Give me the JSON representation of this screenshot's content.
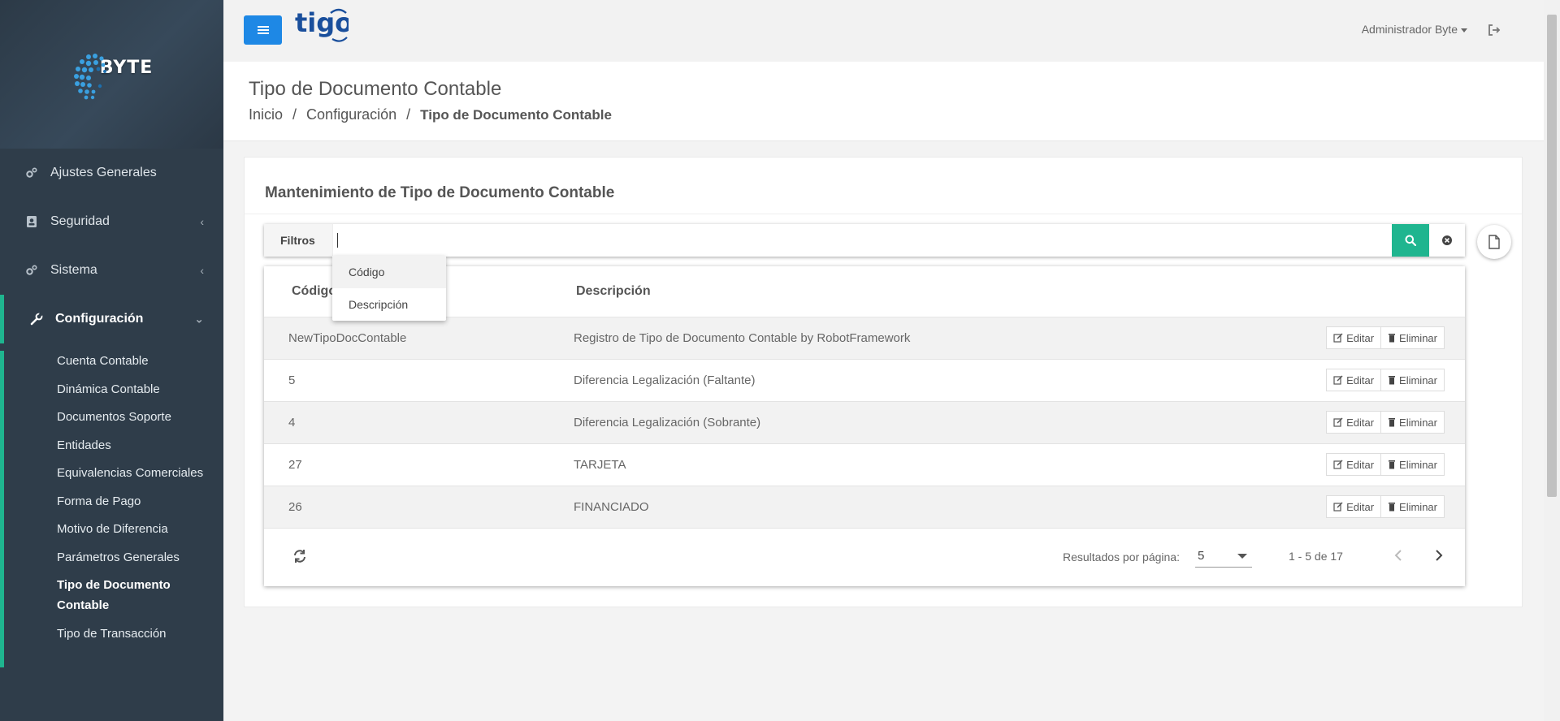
{
  "sidebar": {
    "logo_text": "BYTE",
    "items": [
      {
        "label": "Ajustes Generales",
        "icon": "gears-icon"
      },
      {
        "label": "Seguridad",
        "icon": "id-badge-icon",
        "chevron": "‹"
      },
      {
        "label": "Sistema",
        "icon": "gears-icon",
        "chevron": "‹"
      },
      {
        "label": "Configuración",
        "icon": "wrench-icon",
        "chevron": "⌄"
      }
    ],
    "submenu": [
      "Cuenta Contable",
      "Dinámica Contable",
      "Documentos Soporte",
      "Entidades",
      "Equivalencias Comerciales",
      "Forma de Pago",
      "Motivo de Diferencia",
      "Parámetros Generales",
      "Tipo de Documento Contable",
      "Tipo de Transacción"
    ]
  },
  "topbar": {
    "brand": "tigo",
    "user": "Administrador Byte"
  },
  "header": {
    "title": "Tipo de Documento Contable",
    "breadcrumb": [
      "Inicio",
      "Configuración",
      "Tipo de Documento Contable"
    ],
    "separator": "/"
  },
  "card": {
    "title": "Mantenimiento de Tipo de Documento Contable"
  },
  "filter": {
    "label": "Filtros",
    "value": "",
    "options": [
      "Código",
      "Descripción"
    ]
  },
  "table": {
    "columns": [
      "Código",
      "Descripción"
    ],
    "rows": [
      {
        "code": "NewTipoDocContable",
        "desc": "Registro de Tipo de Documento Contable by RobotFramework"
      },
      {
        "code": "5",
        "desc": "Diferencia Legalización (Faltante)"
      },
      {
        "code": "4",
        "desc": "Diferencia Legalización (Sobrante)"
      },
      {
        "code": "27",
        "desc": "TARJETA"
      },
      {
        "code": "26",
        "desc": "FINANCIADO"
      }
    ],
    "edit_label": "Editar",
    "delete_label": "Eliminar"
  },
  "pagination": {
    "per_page_label": "Resultados por página:",
    "per_page": "5",
    "range": "1 - 5 de 17"
  },
  "colors": {
    "sidebar_bg": "#2f3d4a",
    "accent_green": "#1fb58f",
    "primary_blue": "#1e88e5",
    "tigo_blue": "#1a4f9c"
  }
}
